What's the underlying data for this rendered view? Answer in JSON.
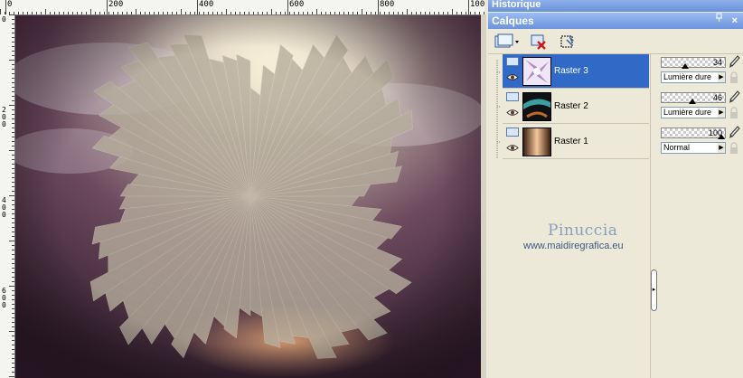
{
  "rulers": {
    "top_labels": [
      "0",
      "200",
      "400",
      "600",
      "800",
      "100"
    ],
    "left_labels": [
      "0",
      "200",
      "400",
      "600"
    ]
  },
  "panels": {
    "historique_title": "Historique",
    "calques_title": "Calques",
    "pin_glyph": "p",
    "close_glyph": "×"
  },
  "layers": [
    {
      "name": "Raster 3",
      "selected": true,
      "opacity": "34",
      "blend_mode": "Lumière dure",
      "opacity_fraction": 0.34
    },
    {
      "name": "Raster 2",
      "selected": false,
      "opacity": "46",
      "blend_mode": "Lumière dure",
      "opacity_fraction": 0.46
    },
    {
      "name": "Raster 1",
      "selected": false,
      "opacity": "100",
      "blend_mode": "Normal",
      "opacity_fraction": 1.0
    }
  ],
  "watermark": {
    "title": "Pinuccia",
    "url": "www.maidiregrafica.eu"
  },
  "icons": {
    "new_layer": "new-raster-layer-icon",
    "delete_layer": "delete-layer-icon",
    "mask": "selection-mask-icon",
    "visibility": "eye-icon",
    "edit": "brush-edit-icon",
    "lock": "lock-icon"
  },
  "colors": {
    "selection": "#3169c6",
    "titlebar": "#7aa0e0",
    "panel_bg": "#ece9d8"
  }
}
